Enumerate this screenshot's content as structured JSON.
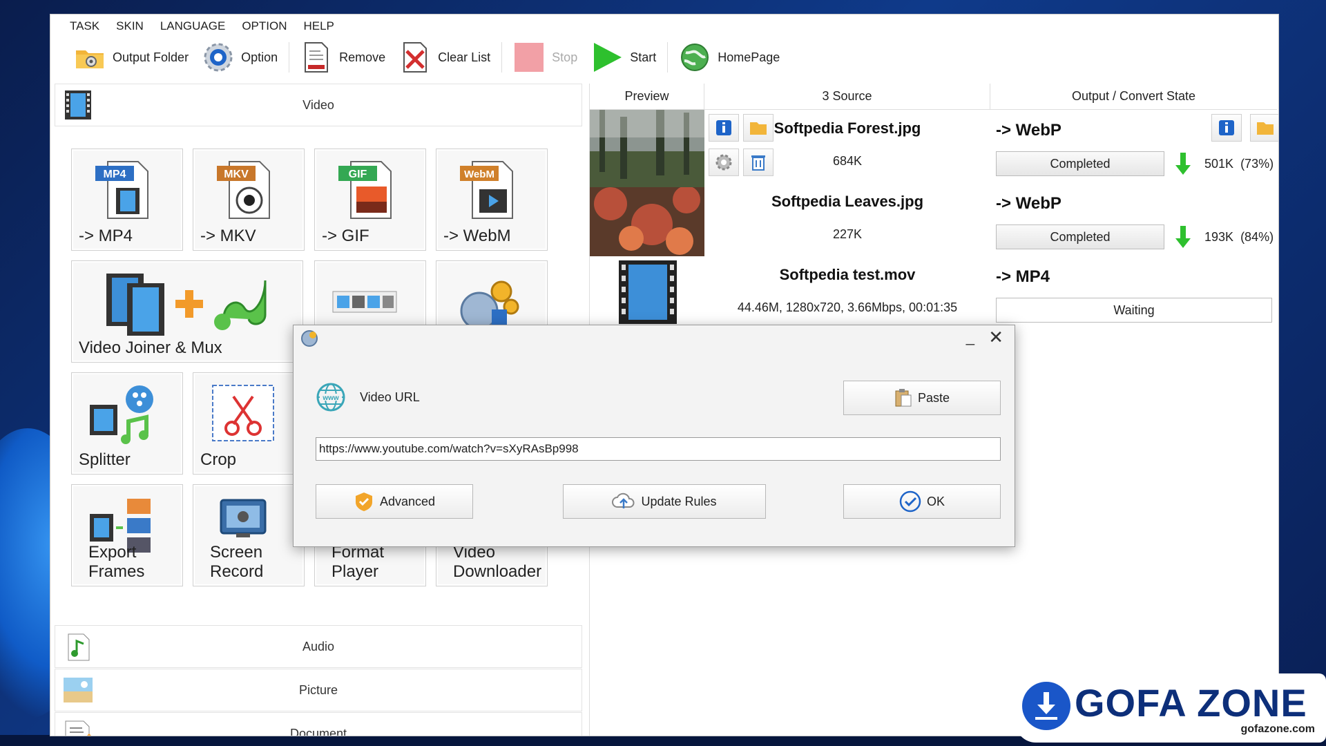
{
  "menu": [
    "TASK",
    "SKIN",
    "LANGUAGE",
    "OPTION",
    "HELP"
  ],
  "toolbar": {
    "output_folder": "Output Folder",
    "option": "Option",
    "remove": "Remove",
    "clear_list": "Clear List",
    "stop": "Stop",
    "start": "Start",
    "homepage": "HomePage"
  },
  "left": {
    "video_header": "Video",
    "tiles": {
      "mp4": "-> MP4",
      "mkv": "-> MKV",
      "gif": "-> GIF",
      "webm": "-> WebM",
      "joiner": "Video Joiner & Mux",
      "splitter": "Splitter",
      "crop": "Crop",
      "export_frames": "Export\nFrames",
      "screen_record": "Screen\nRecord",
      "format_player": "Format\nPlayer",
      "video_downloader": "Video\nDownloader"
    },
    "icon_badges": {
      "mp4": "MP4",
      "mkv": "MKV",
      "gif": "GIF",
      "webm": "WebM"
    },
    "audio_header": "Audio",
    "picture_header": "Picture",
    "document_header": "Document"
  },
  "list": {
    "col_preview": "Preview",
    "col_source": "3 Source",
    "col_state": "Output / Convert State",
    "rows": [
      {
        "name": "Softpedia Forest.jpg",
        "size": "684K",
        "target": "-> WebP",
        "state": "Completed",
        "out_size": "501K",
        "ratio": "(73%)"
      },
      {
        "name": "Softpedia Leaves.jpg",
        "size": "227K",
        "target": "-> WebP",
        "state": "Completed",
        "out_size": "193K",
        "ratio": "(84%)"
      },
      {
        "name": "Softpedia test.mov",
        "size": "44.46M, 1280x720, 3.66Mbps, 00:01:35",
        "target": "-> MP4",
        "state": "Waiting"
      }
    ]
  },
  "dialog": {
    "label": "Video URL",
    "paste": "Paste",
    "url": "https://www.youtube.com/watch?v=sXyRAsBp998",
    "advanced": "Advanced",
    "update_rules": "Update Rules",
    "ok": "OK"
  },
  "watermark": {
    "brand": "GOFA ZONE",
    "site": "gofazone.com"
  },
  "colors": {
    "accent_green": "#2ec02e",
    "brand_blue": "#0d2f7a",
    "info_blue": "#1e64c8"
  }
}
